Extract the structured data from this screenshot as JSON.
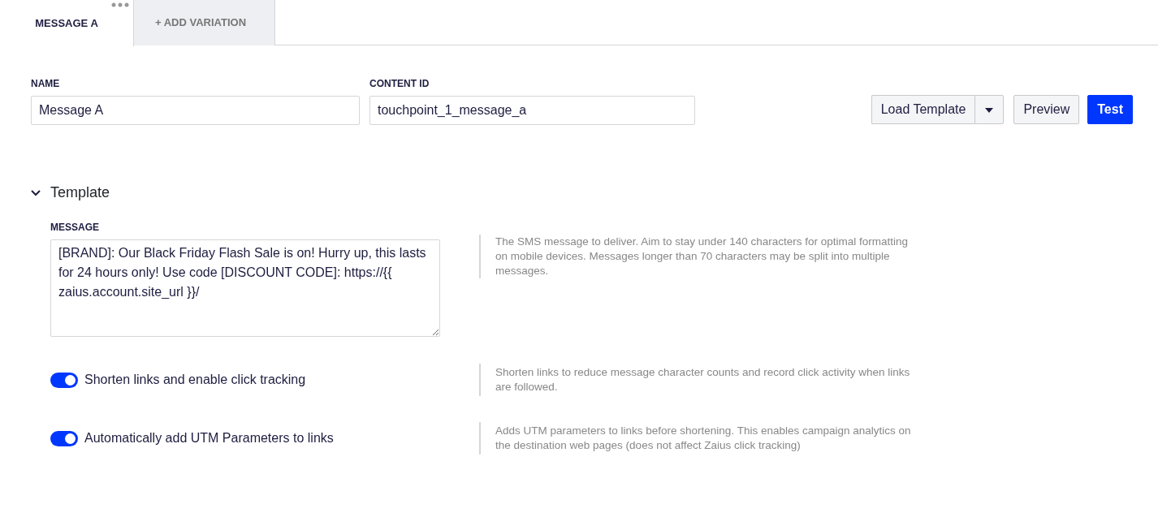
{
  "tabs": [
    {
      "label": "MESSAGE A",
      "selected": true,
      "has_menu": true
    },
    {
      "label": "+ ADD VARIATION",
      "selected": false,
      "has_menu": false
    }
  ],
  "fields": [
    {
      "label": "NAME",
      "value": "Message A"
    },
    {
      "label": "CONTENT ID",
      "value": "touchpoint_1_message_a"
    }
  ],
  "buttons": [
    {
      "label": "Load Template",
      "kind": "split"
    },
    {
      "label": "Preview",
      "kind": "secondary"
    },
    {
      "label": "Test",
      "kind": "primary"
    }
  ],
  "section": {
    "title": "Template",
    "expanded": true,
    "message": {
      "label": "MESSAGE",
      "value": "[BRAND]: Our Black Friday Flash Sale is on! Hurry up, this lasts for 24 hours only! Use code [DISCOUNT CODE]: https://{{ zaius.account.site_url }}/",
      "help": "The SMS message to deliver. Aim to stay under 140 characters for optimal formatting on mobile devices. Messages longer than 70 characters may be split into multiple messages."
    },
    "toggles": [
      {
        "label": "Shorten links and enable click tracking",
        "on": true,
        "help": "Shorten links to reduce message character counts and record click activity when links are followed."
      },
      {
        "label": "Automatically add UTM Parameters to links",
        "on": true,
        "help": "Adds UTM parameters to links before shortening. This enables campaign analytics on the destination web pages (does not affect Zaius click tracking)"
      }
    ]
  }
}
